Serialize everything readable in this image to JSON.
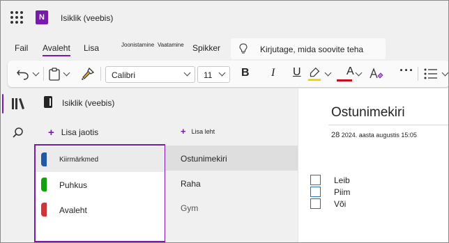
{
  "app": {
    "title": "Isiklik (veebis)",
    "app_icon_letter": "N",
    "brand_color": "#7719aa"
  },
  "tabs": [
    {
      "label": "Fail"
    },
    {
      "label": "Avaleht",
      "active": true
    },
    {
      "label": "Lisa"
    },
    {
      "label": "Joonistamine"
    },
    {
      "label": "Vaatamine"
    },
    {
      "label": "Spikker"
    }
  ],
  "search": {
    "text": "Kirjutage, mida soovite teha",
    "icon": "lightbulb-icon"
  },
  "ribbon": {
    "font_name": "Calibri",
    "font_size": "11",
    "bold_label": "B",
    "italic_label": "I",
    "underline_label": "U",
    "font_color_label": "A",
    "more_label": "···",
    "highlight_color": "#e8d200",
    "font_color": "#c50f1f",
    "icons": [
      "undo-icon",
      "paste-icon",
      "format-painter-icon",
      "highlighter-icon",
      "font-color-icon",
      "clear-format-icon",
      "more-icon",
      "bullets-icon"
    ]
  },
  "rail": {
    "icons": [
      "notebooks-icon",
      "search-icon"
    ]
  },
  "notebook": {
    "name": "Isiklik (veebis)"
  },
  "sections": {
    "add_label": "Lisa jaotis",
    "items": [
      {
        "label": "Kiirmärkmed",
        "color": "#1e5aa8",
        "selected": true
      },
      {
        "label": "Puhkus",
        "color": "#13a10e"
      },
      {
        "label": "Avaleht",
        "color": "#d13438"
      }
    ]
  },
  "pages": {
    "add_label": "Lisa leht",
    "items": [
      {
        "label": "Ostunimekiri",
        "selected": true
      },
      {
        "label": "Raha"
      },
      {
        "label": "Gym"
      }
    ]
  },
  "page": {
    "title": "Ostunimekiri",
    "date_day": "28",
    "date_rest": "2024. aasta augustis 15:05",
    "todos": [
      {
        "label": "Leib",
        "checked": false
      },
      {
        "label": "Piim",
        "checked": false
      },
      {
        "label": "Või",
        "checked": false
      }
    ]
  }
}
